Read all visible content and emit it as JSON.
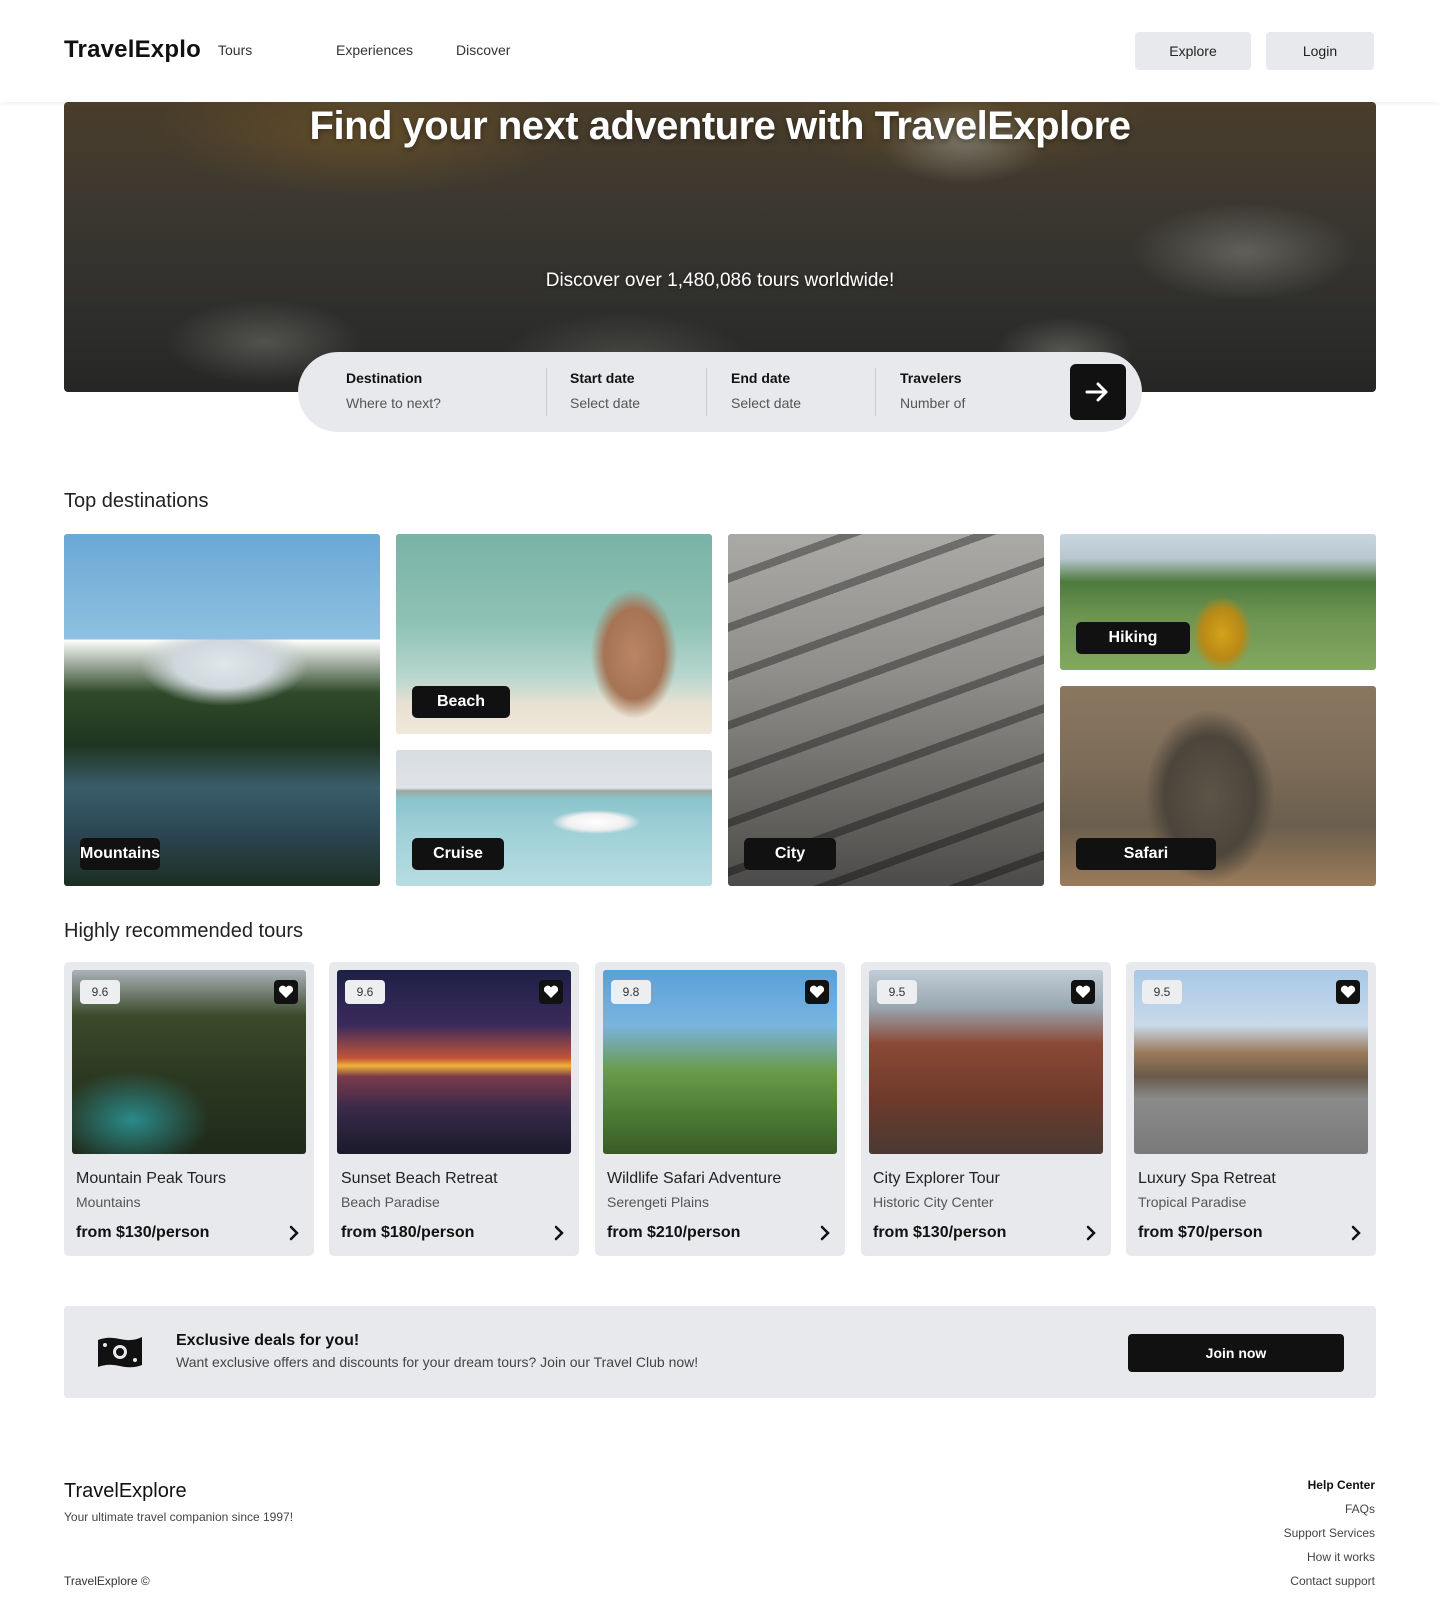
{
  "header": {
    "logo": "TravelExplo",
    "nav": [
      "Tours",
      "Experiences",
      "Discover"
    ],
    "explore_label": "Explore",
    "login_label": "Login"
  },
  "hero": {
    "title": "Find your next adventure with TravelExplore",
    "subtitle": "Discover over 1,480,086 tours worldwide!"
  },
  "search": {
    "fields": [
      {
        "label": "Destination",
        "placeholder": "Where to next?"
      },
      {
        "label": "Start date",
        "placeholder": "Select date"
      },
      {
        "label": "End date",
        "placeholder": "Select date"
      },
      {
        "label": "Travelers",
        "placeholder": "Number of"
      }
    ],
    "submit_icon": "arrow-right-icon"
  },
  "destinations": {
    "title": "Top destinations",
    "tiles": [
      "Mountains",
      "Beach",
      "Cruise",
      "City",
      "Hiking",
      "Safari"
    ]
  },
  "tours": {
    "title": "Highly recommended tours",
    "items": [
      {
        "score": "9.6",
        "name": "Mountain Peak Tours",
        "location": "Mountains",
        "price": "from $130/person"
      },
      {
        "score": "9.6",
        "name": "Sunset Beach Retreat",
        "location": "Beach Paradise",
        "price": "from $180/person"
      },
      {
        "score": "9.8",
        "name": "Wildlife Safari Adventure",
        "location": "Serengeti Plains",
        "price": "from $210/person"
      },
      {
        "score": "9.5",
        "name": "City Explorer Tour",
        "location": "Historic City Center",
        "price": "from $130/person"
      },
      {
        "score": "9.5",
        "name": "Luxury Spa Retreat",
        "location": "Tropical Paradise",
        "price": "from $70/person"
      }
    ]
  },
  "deals": {
    "icon": "money-icon",
    "title": "Exclusive deals for you!",
    "text": "Want exclusive offers and discounts for your dream tours? Join our Travel Club now!",
    "button": "Join now"
  },
  "footer": {
    "brand": "TravelExplore",
    "tagline": "Your ultimate travel companion since 1997!",
    "copyright": "TravelExplore ©",
    "links_heading": "Help Center",
    "links": [
      "FAQs",
      "Support Services",
      "How it works",
      "Contact support"
    ]
  }
}
